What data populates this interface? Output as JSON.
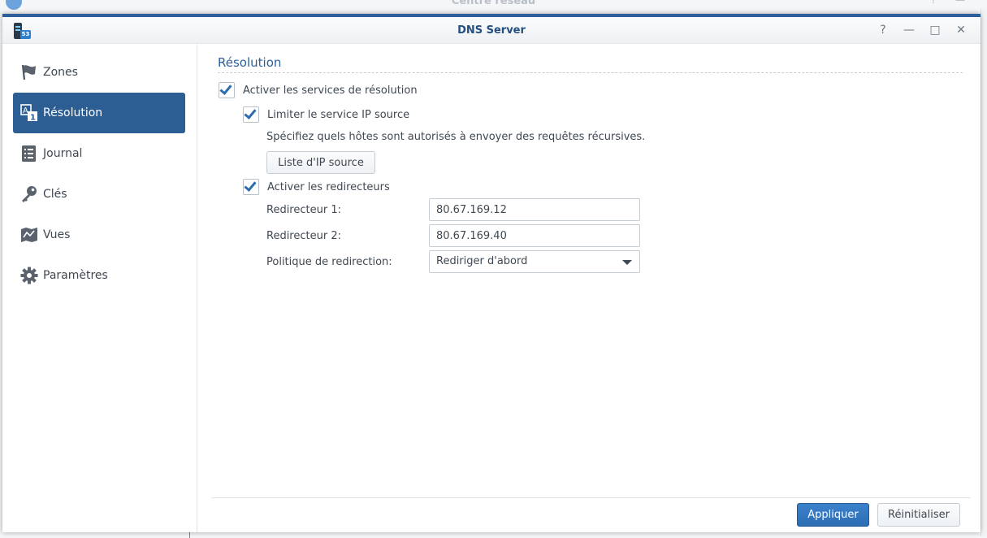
{
  "background_window": {
    "title": "Centre réseau"
  },
  "window": {
    "title": "DNS Server",
    "app_icon_badge": "53",
    "controls": {
      "help": "?",
      "minimize": "—",
      "maximize": "□",
      "close": "✕"
    }
  },
  "sidebar": {
    "items": [
      {
        "label": "Zones",
        "icon": "flag-icon",
        "active": false
      },
      {
        "label": "Résolution",
        "icon": "resolution-icon",
        "active": true
      },
      {
        "label": "Journal",
        "icon": "log-icon",
        "active": false
      },
      {
        "label": "Clés",
        "icon": "key-icon",
        "active": false
      },
      {
        "label": "Vues",
        "icon": "views-icon",
        "active": false
      },
      {
        "label": "Paramètres",
        "icon": "gear-icon",
        "active": false
      }
    ]
  },
  "resolution": {
    "section_title": "Résolution",
    "enable_resolution": {
      "label": "Activer les services de résolution",
      "checked": true
    },
    "limit_source_ip": {
      "label": "Limiter le service IP source",
      "checked": true
    },
    "description": "Spécifiez quels hôtes sont autorisés à envoyer des requêtes récursives.",
    "source_ip_list_button": "Liste d'IP source",
    "enable_forwarders": {
      "label": "Activer les redirecteurs",
      "checked": true
    },
    "forwarder1": {
      "label": "Redirecteur 1:",
      "value": "80.67.169.12"
    },
    "forwarder2": {
      "label": "Redirecteur 2:",
      "value": "80.67.169.40"
    },
    "forward_policy": {
      "label": "Politique de redirection:",
      "value": "Rediriger d'abord"
    }
  },
  "footer": {
    "apply": "Appliquer",
    "reset": "Réinitialiser"
  },
  "colors": {
    "accent": "#2c5d93",
    "primary_button": "#3479c0",
    "title_text": "#244f7f"
  }
}
